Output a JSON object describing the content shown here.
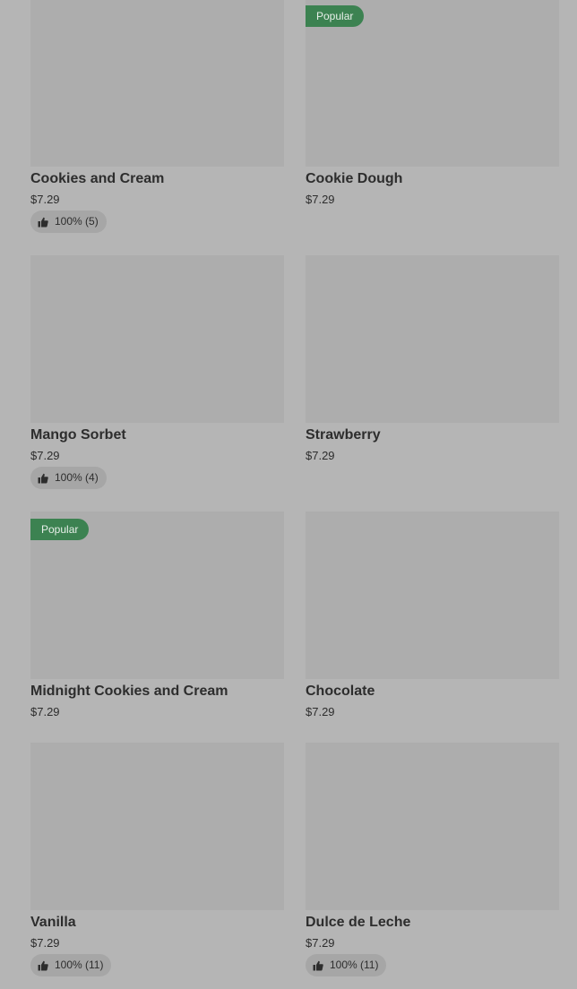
{
  "items": [
    {
      "name": "Cookies and Cream",
      "price": "$7.29",
      "badge": "",
      "rating": "100% (5)"
    },
    {
      "name": "Cookie Dough",
      "price": "$7.29",
      "badge": "Popular",
      "rating": ""
    },
    {
      "name": "Mango Sorbet",
      "price": "$7.29",
      "badge": "",
      "rating": "100% (4)"
    },
    {
      "name": "Strawberry",
      "price": "$7.29",
      "badge": "",
      "rating": ""
    },
    {
      "name": "Midnight Cookies and Cream",
      "price": "$7.29",
      "badge": "Popular",
      "rating": ""
    },
    {
      "name": "Chocolate",
      "price": "$7.29",
      "badge": "",
      "rating": ""
    },
    {
      "name": "Vanilla",
      "price": "$7.29",
      "badge": "",
      "rating": "100% (11)"
    },
    {
      "name": "Dulce de Leche",
      "price": "$7.29",
      "badge": "",
      "rating": "100% (11)"
    }
  ],
  "colors": {
    "badge_green": "#3c8251",
    "placeholder_gray": "#adadad"
  }
}
